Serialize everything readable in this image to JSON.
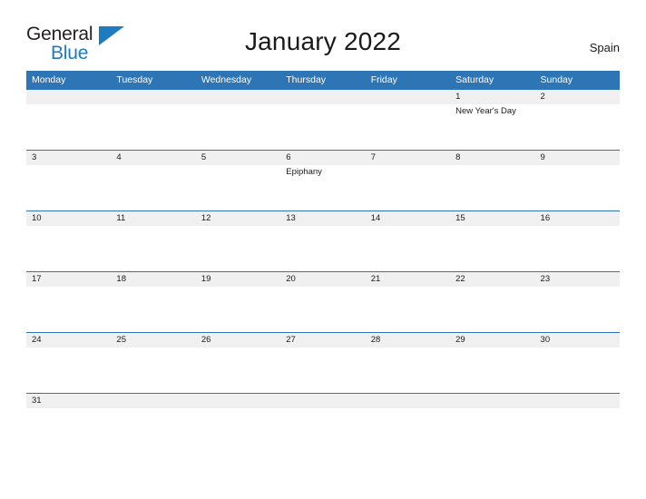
{
  "brand": {
    "name_top": "General",
    "name_bottom": "Blue",
    "flag_icon": "blue-triangle-flag-icon",
    "color_dark": "#231f20",
    "color_blue": "#1f7bc1"
  },
  "header": {
    "title": "January 2022",
    "country": "Spain"
  },
  "theme": {
    "header_blue": "#2e75b6",
    "date_band_gray": "#f0f0f0",
    "text_dark": "#1a1a1a",
    "page_background": "#ffffff"
  },
  "calendar": {
    "month": "January",
    "year": "2022",
    "weekday_headers": [
      "Monday",
      "Tuesday",
      "Wednesday",
      "Thursday",
      "Friday",
      "Saturday",
      "Sunday"
    ],
    "weeks": [
      {
        "days": [
          {
            "num": "",
            "event": ""
          },
          {
            "num": "",
            "event": ""
          },
          {
            "num": "",
            "event": ""
          },
          {
            "num": "",
            "event": ""
          },
          {
            "num": "",
            "event": ""
          },
          {
            "num": "1",
            "event": "New Year's Day"
          },
          {
            "num": "2",
            "event": ""
          }
        ]
      },
      {
        "days": [
          {
            "num": "3",
            "event": ""
          },
          {
            "num": "4",
            "event": ""
          },
          {
            "num": "5",
            "event": ""
          },
          {
            "num": "6",
            "event": "Epiphany"
          },
          {
            "num": "7",
            "event": ""
          },
          {
            "num": "8",
            "event": ""
          },
          {
            "num": "9",
            "event": ""
          }
        ]
      },
      {
        "days": [
          {
            "num": "10",
            "event": ""
          },
          {
            "num": "11",
            "event": ""
          },
          {
            "num": "12",
            "event": ""
          },
          {
            "num": "13",
            "event": ""
          },
          {
            "num": "14",
            "event": ""
          },
          {
            "num": "15",
            "event": ""
          },
          {
            "num": "16",
            "event": ""
          }
        ]
      },
      {
        "days": [
          {
            "num": "17",
            "event": ""
          },
          {
            "num": "18",
            "event": ""
          },
          {
            "num": "19",
            "event": ""
          },
          {
            "num": "20",
            "event": ""
          },
          {
            "num": "21",
            "event": ""
          },
          {
            "num": "22",
            "event": ""
          },
          {
            "num": "23",
            "event": ""
          }
        ]
      },
      {
        "days": [
          {
            "num": "24",
            "event": ""
          },
          {
            "num": "25",
            "event": ""
          },
          {
            "num": "26",
            "event": ""
          },
          {
            "num": "27",
            "event": ""
          },
          {
            "num": "28",
            "event": ""
          },
          {
            "num": "29",
            "event": ""
          },
          {
            "num": "30",
            "event": ""
          }
        ]
      },
      {
        "days": [
          {
            "num": "31",
            "event": ""
          },
          {
            "num": "",
            "event": ""
          },
          {
            "num": "",
            "event": ""
          },
          {
            "num": "",
            "event": ""
          },
          {
            "num": "",
            "event": ""
          },
          {
            "num": "",
            "event": ""
          },
          {
            "num": "",
            "event": ""
          }
        ]
      }
    ]
  }
}
